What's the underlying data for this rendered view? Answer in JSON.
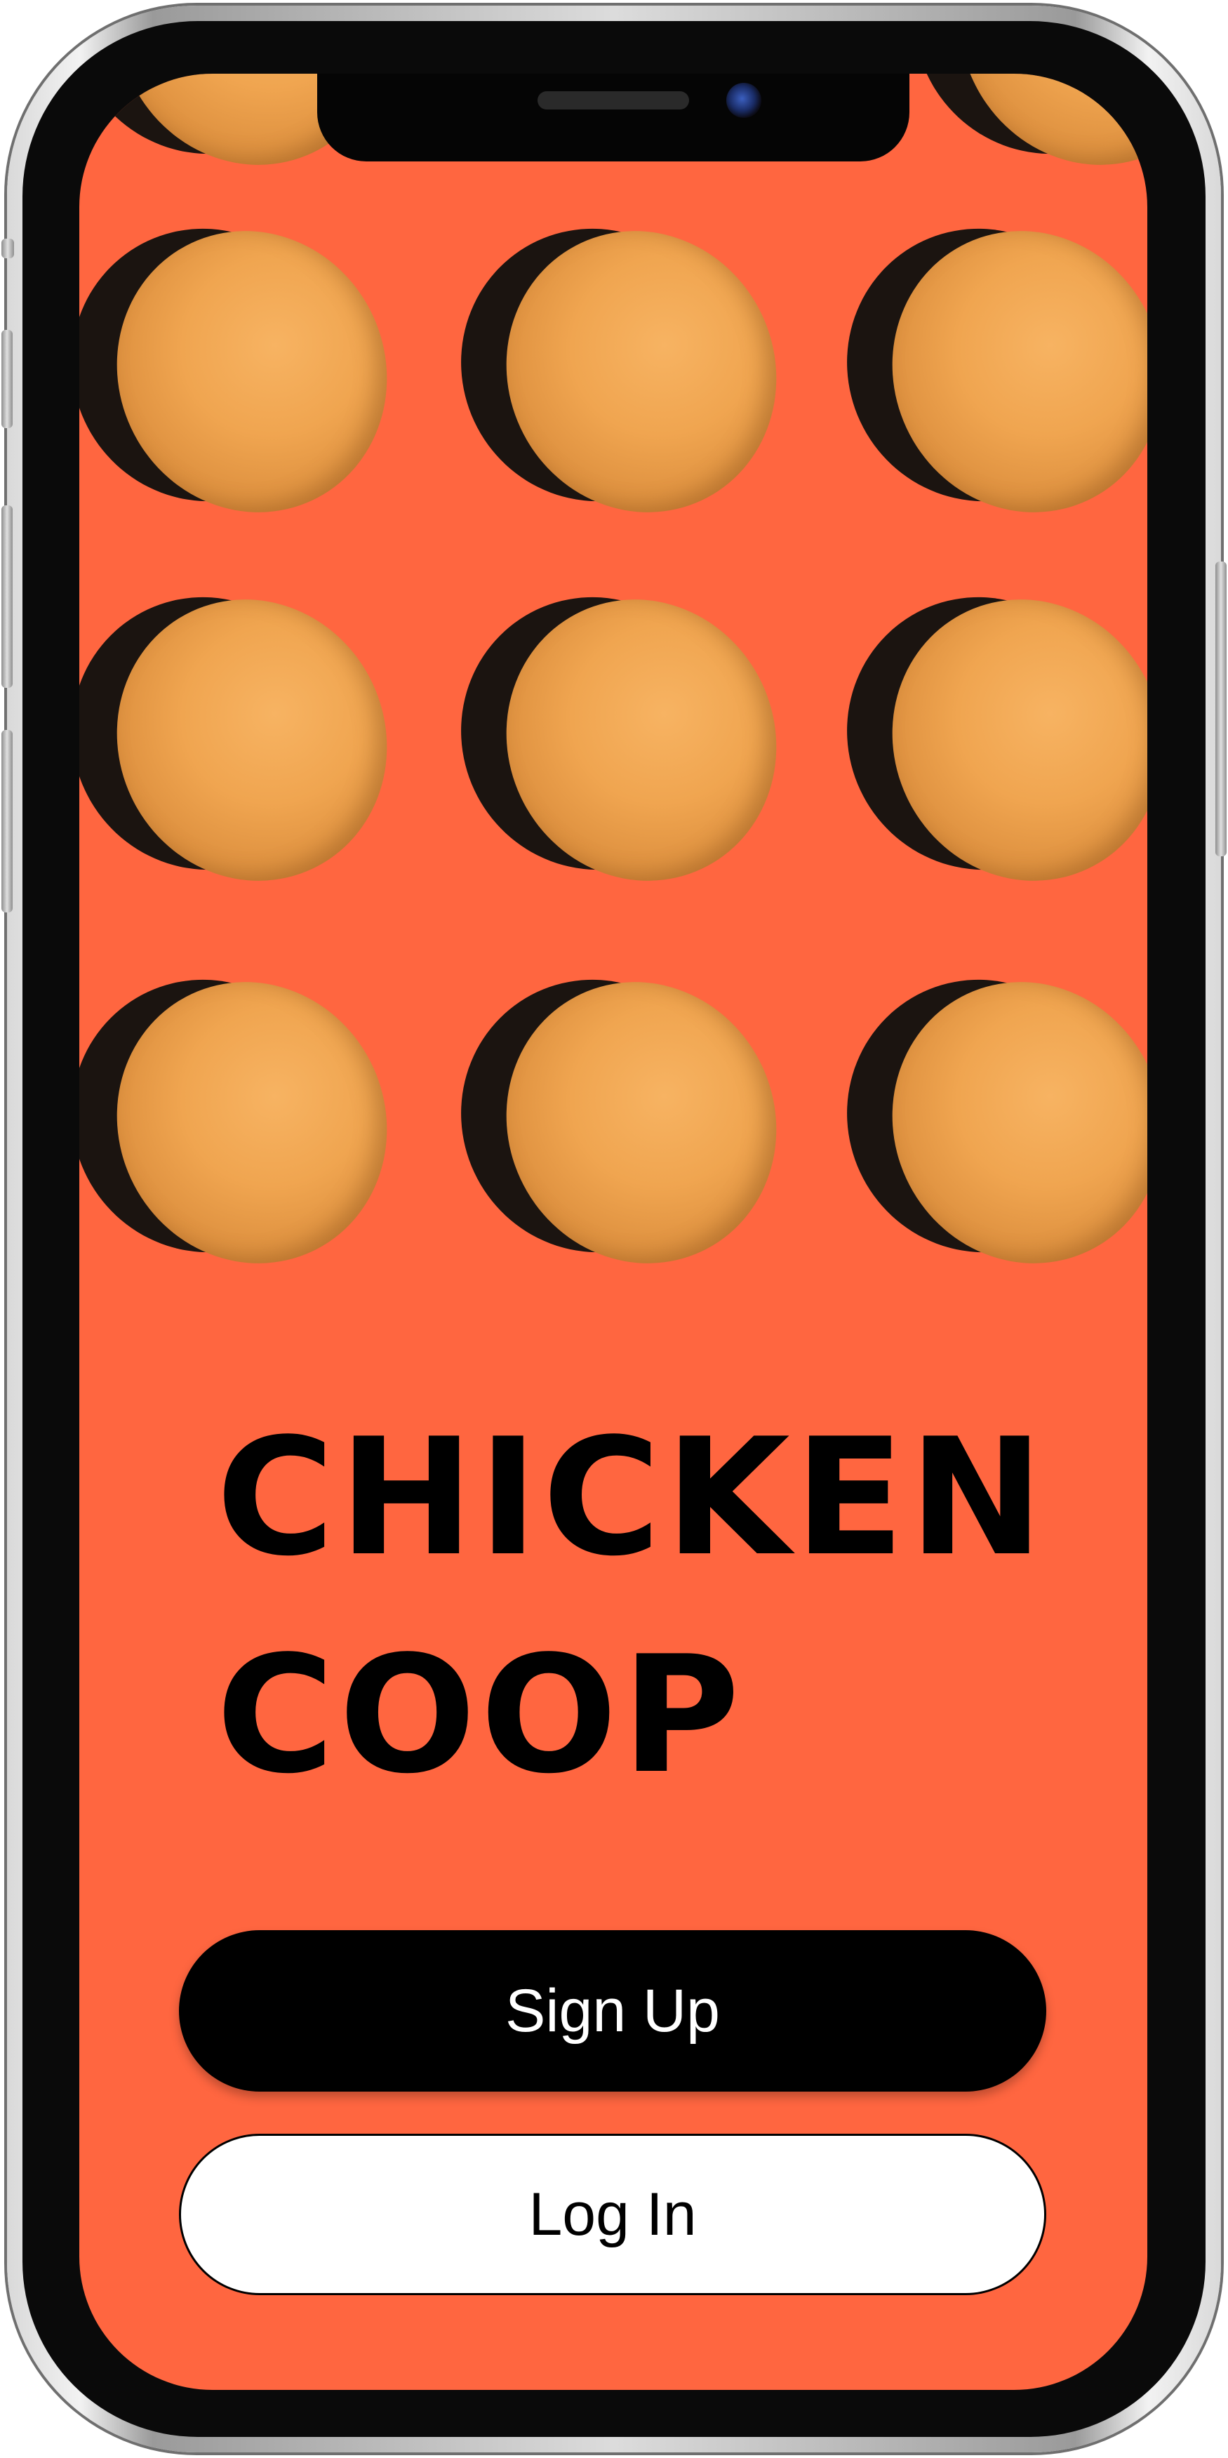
{
  "app": {
    "title_line1": "CHICKEN",
    "title_line2": "COOP"
  },
  "buttons": {
    "signup_label": "Sign Up",
    "login_label": "Log In"
  },
  "colors": {
    "background": "#ff6640",
    "primary_button": "#000000",
    "secondary_button": "#ffffff"
  },
  "hero": {
    "image": "eggs-pattern"
  }
}
